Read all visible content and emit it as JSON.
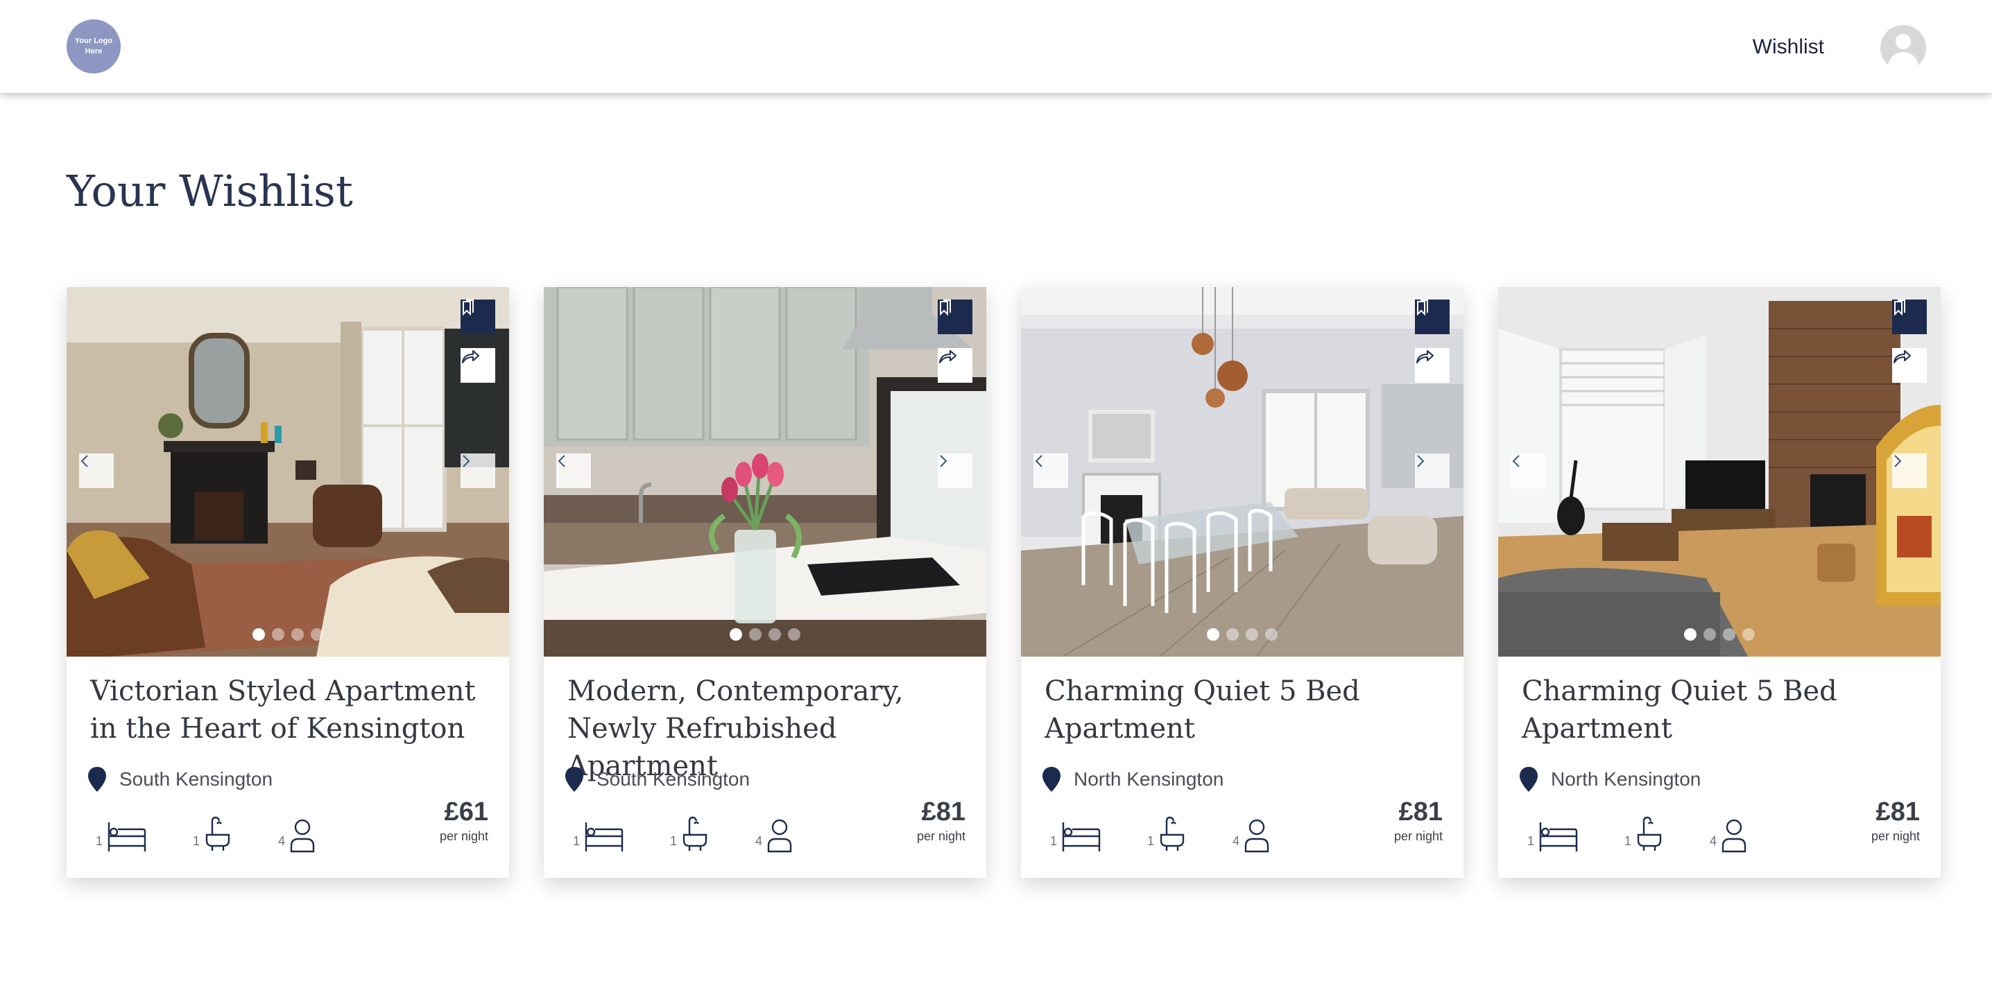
{
  "header": {
    "logo_text": "Your Logo\nHere",
    "nav_wishlist": "Wishlist"
  },
  "page": {
    "title": "Your Wishlist"
  },
  "colors": {
    "brand_navy": "#1c2a4e",
    "logo_bg": "#8d97c2",
    "avatar_bg": "#d8d8d8"
  },
  "listings": [
    {
      "title": "Victorian Styled Apartment in the Heart of Kensington",
      "location": "South Kensington",
      "beds": "1",
      "baths": "1",
      "guests": "4",
      "price": "£61",
      "price_unit": "per night",
      "photo_count": 4,
      "active_photo": 1
    },
    {
      "title": "Modern, Contemporary, Newly Refrubished Apartment",
      "location": "South Kensington",
      "beds": "1",
      "baths": "1",
      "guests": "4",
      "price": "£81",
      "price_unit": "per night",
      "photo_count": 4,
      "active_photo": 1
    },
    {
      "title": "Charming Quiet 5 Bed Apartment",
      "location": "North Kensington",
      "beds": "1",
      "baths": "1",
      "guests": "4",
      "price": "£81",
      "price_unit": "per night",
      "photo_count": 4,
      "active_photo": 1
    },
    {
      "title": "Charming Quiet 5 Bed Apartment",
      "location": "North Kensington",
      "beds": "1",
      "baths": "1",
      "guests": "4",
      "price": "£81",
      "price_unit": "per night",
      "photo_count": 4,
      "active_photo": 1
    }
  ],
  "icons": {
    "bookmark": "bookmark-icon",
    "share": "share-icon",
    "prev": "chevron-left-icon",
    "next": "chevron-right-icon",
    "pin": "location-pin-icon",
    "bed": "bed-icon",
    "bath": "bath-icon",
    "guest": "person-icon"
  }
}
